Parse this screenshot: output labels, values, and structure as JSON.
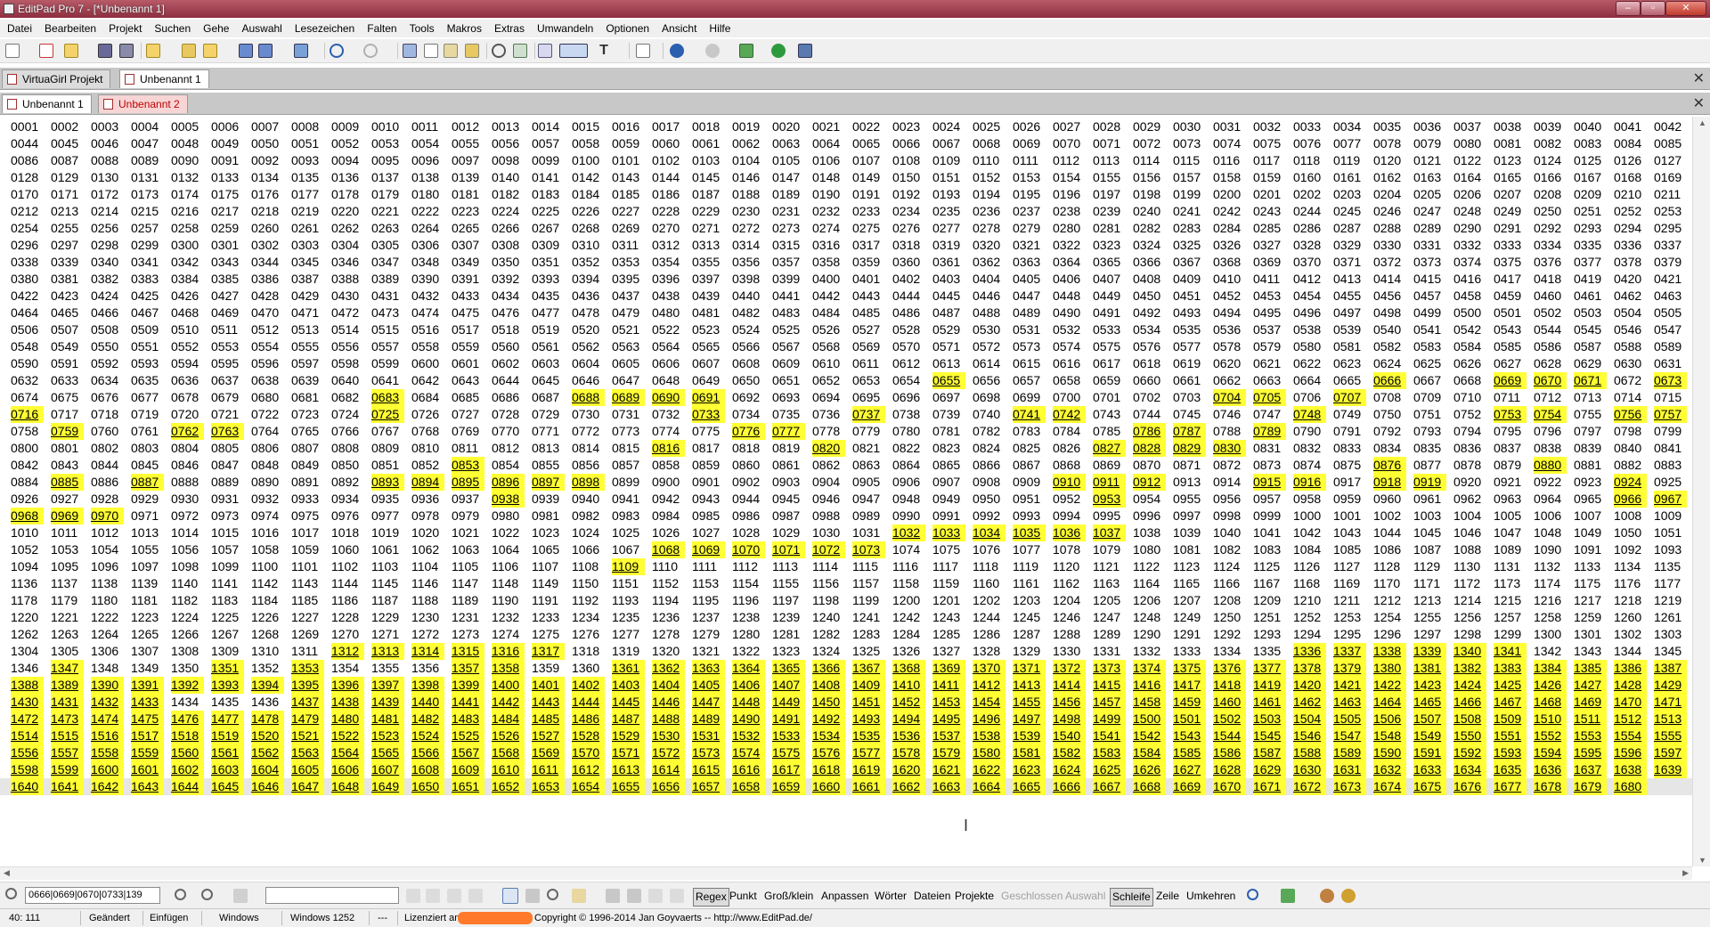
{
  "window": {
    "title": "EditPad Pro 7 - [*Unbenannt 1]"
  },
  "menu": [
    "Datei",
    "Bearbeiten",
    "Projekt",
    "Suchen",
    "Gehe",
    "Auswahl",
    "Lesezeichen",
    "Falten",
    "Tools",
    "Makros",
    "Extras",
    "Umwandeln",
    "Optionen",
    "Ansicht",
    "Hilfe"
  ],
  "project_tabs": [
    {
      "label": "VirtuaGirl Projekt",
      "active": false
    },
    {
      "label": "Unbenannt 1",
      "active": true
    }
  ],
  "file_tabs": [
    {
      "label": "Unbenannt 1",
      "active": true
    },
    {
      "label": "Unbenannt 2",
      "active": false
    }
  ],
  "editor": {
    "start": 1,
    "end": 1680,
    "per_line": 42,
    "extra_first_line": 1,
    "highlighted_ranges": [
      [
        655,
        655
      ],
      [
        666,
        666
      ],
      [
        669,
        671
      ],
      [
        673,
        673
      ],
      [
        683,
        683
      ],
      [
        688,
        691
      ],
      [
        704,
        705
      ],
      [
        707,
        707
      ],
      [
        716,
        716
      ],
      [
        725,
        725
      ],
      [
        733,
        733
      ],
      [
        737,
        737
      ],
      [
        741,
        742
      ],
      [
        748,
        748
      ],
      [
        753,
        754
      ],
      [
        756,
        757
      ],
      [
        759,
        759
      ],
      [
        762,
        763
      ],
      [
        776,
        777
      ],
      [
        786,
        787
      ],
      [
        789,
        789
      ],
      [
        816,
        816
      ],
      [
        820,
        820
      ],
      [
        827,
        830
      ],
      [
        853,
        853
      ],
      [
        876,
        876
      ],
      [
        880,
        880
      ],
      [
        885,
        885
      ],
      [
        887,
        887
      ],
      [
        893,
        898
      ],
      [
        910,
        912
      ],
      [
        915,
        916
      ],
      [
        918,
        919
      ],
      [
        924,
        924
      ],
      [
        938,
        938
      ],
      [
        953,
        953
      ],
      [
        966,
        970
      ],
      [
        1032,
        1037
      ],
      [
        1068,
        1073
      ],
      [
        1109,
        1109
      ],
      [
        1312,
        1317
      ],
      [
        1336,
        1341
      ],
      [
        1347,
        1347
      ],
      [
        1351,
        1351
      ],
      [
        1353,
        1353
      ],
      [
        1357,
        1358
      ],
      [
        1361,
        1433
      ],
      [
        1437,
        1680
      ]
    ]
  },
  "search": {
    "value": "0666|0669|0670|0733|139"
  },
  "search_options": [
    {
      "label": "Regex",
      "state": "on"
    },
    {
      "label": "Punkt",
      "state": "off"
    },
    {
      "label": "Groß/klein",
      "state": "off"
    },
    {
      "label": "Anpassen",
      "state": "off"
    },
    {
      "label": "Wörter",
      "state": "off"
    },
    {
      "label": "Dateien",
      "state": "off"
    },
    {
      "label": "Projekte",
      "state": "off"
    },
    {
      "label": "Geschlossen",
      "state": "disabled"
    },
    {
      "label": "Auswahl",
      "state": "disabled"
    },
    {
      "label": "Schleife",
      "state": "on"
    },
    {
      "label": "Zeile",
      "state": "off"
    },
    {
      "label": "Umkehren",
      "state": "off"
    }
  ],
  "status": {
    "position": "40: 111",
    "modified": "Geändert",
    "insert": "Einfügen",
    "line_break": "Windows",
    "encoding": "Windows 1252",
    "dash": "---",
    "licensed": "Lizenziert an",
    "copyright": "Copyright © 1996-2014  Jan Goyvaerts  --  http://www.EditPad.de/"
  },
  "colors": {
    "highlight": "#ffff33",
    "title_bar": "#8e2f40",
    "tab_red": "#c00000",
    "redaction": "#ff7a2a"
  }
}
